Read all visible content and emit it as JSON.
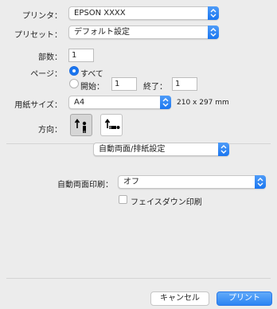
{
  "printer": {
    "label": "プリンタ：",
    "value": "EPSON XXXX"
  },
  "preset": {
    "label": "プリセット：",
    "value": "デフォルト設定"
  },
  "copies": {
    "label": "部数：",
    "value": "1"
  },
  "pages": {
    "label": "ページ：",
    "all_label": "すべて",
    "start_label": "開始：",
    "start_value": "1",
    "end_label": "終了：",
    "end_value": "1"
  },
  "paper": {
    "label": "用紙サイズ：",
    "value": "A4",
    "size_text": "210 x 297 mm"
  },
  "orientation": {
    "label": "方向："
  },
  "section": {
    "value": "自動両面/排紙設定"
  },
  "duplex": {
    "label": "自動両面印刷：",
    "value": "オフ"
  },
  "facedown": {
    "label": "フェイスダウン印刷"
  },
  "buttons": {
    "cancel": "キャンセル",
    "print": "プリント"
  },
  "colors": {
    "accent": "#1a76f0",
    "background": "#ececec"
  }
}
